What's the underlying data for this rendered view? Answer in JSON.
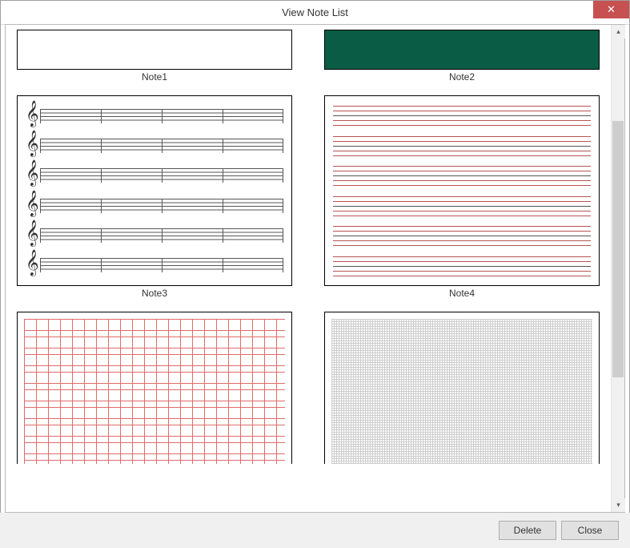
{
  "window": {
    "title": "View Note List"
  },
  "notes": {
    "n1": {
      "label": "Note1"
    },
    "n2": {
      "label": "Note2"
    },
    "n3": {
      "label": "Note3"
    },
    "n4": {
      "label": "Note4"
    }
  },
  "footer": {
    "delete_label": "Delete",
    "close_label": "Close"
  },
  "icons": {
    "close_x": "✕",
    "up": "▴",
    "down": "▾",
    "clef": "𝄞"
  }
}
